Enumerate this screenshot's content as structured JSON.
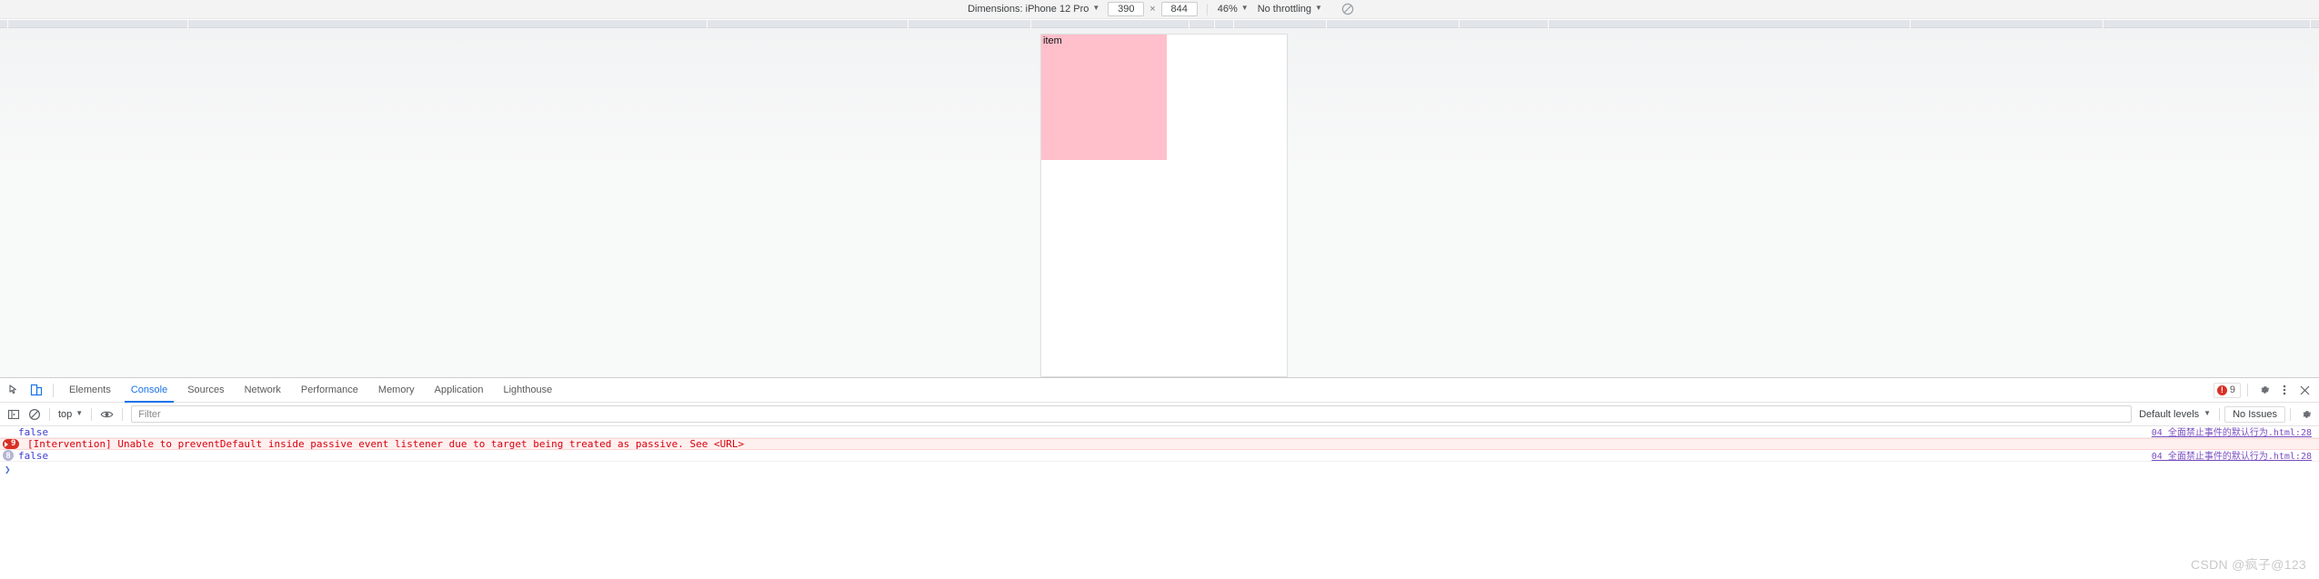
{
  "device_toolbar": {
    "dimensions_label": "Dimensions: iPhone 12 Pro",
    "width_value": "390",
    "times_symbol": "×",
    "height_value": "844",
    "zoom_label": "46%",
    "throttling_label": "No throttling",
    "rotate_icon": "rotate-device-icon",
    "caret": "▼"
  },
  "ruler": {
    "tick_positions": [
      8,
      206,
      777,
      998,
      1133,
      1307,
      1335,
      1356,
      1458,
      1604,
      1702,
      2100,
      2312,
      2540
    ]
  },
  "page": {
    "item_label": "item",
    "item_color": "#ffc0cb",
    "viewport_background": "#ffffff"
  },
  "devtools": {
    "inspect_icon": "inspect-element-icon",
    "device_toggle_icon": "device-toolbar-icon",
    "tabs": [
      {
        "label": "Elements",
        "active": false
      },
      {
        "label": "Console",
        "active": true
      },
      {
        "label": "Sources",
        "active": false
      },
      {
        "label": "Network",
        "active": false
      },
      {
        "label": "Performance",
        "active": false
      },
      {
        "label": "Memory",
        "active": false
      },
      {
        "label": "Application",
        "active": false
      },
      {
        "label": "Lighthouse",
        "active": false
      }
    ],
    "error_count": "9",
    "settings_icon": "gear-icon",
    "more_icon": "more-vertical-icon",
    "close_icon": "close-icon",
    "accent_color": "#1a73e8",
    "error_color": "#d93025"
  },
  "console_toolbar": {
    "sidebar_icon": "console-sidebar-icon",
    "clear_icon": "clear-console-icon",
    "context_label": "top",
    "eye_icon": "live-expression-icon",
    "filter_placeholder": "Filter",
    "filter_value": "",
    "levels_label": "Default levels",
    "issues_label": "No Issues",
    "settings_icon": "gear-icon",
    "caret": "▼"
  },
  "console_messages": [
    {
      "type": "log",
      "badge": "",
      "text": "false",
      "source": "04 全面禁止事件的默认行为.html:28"
    },
    {
      "type": "error",
      "badge": "9",
      "text": "[Intervention] Unable to preventDefault inside passive event listener due to target being treated as passive. See <URL>",
      "source": ""
    },
    {
      "type": "info",
      "badge": "8",
      "text": "false",
      "source": "04 全面禁止事件的默认行为.html:28"
    }
  ],
  "console_prompt": {
    "caret": "❯"
  },
  "watermark": {
    "text": "CSDN @疯子@123"
  }
}
